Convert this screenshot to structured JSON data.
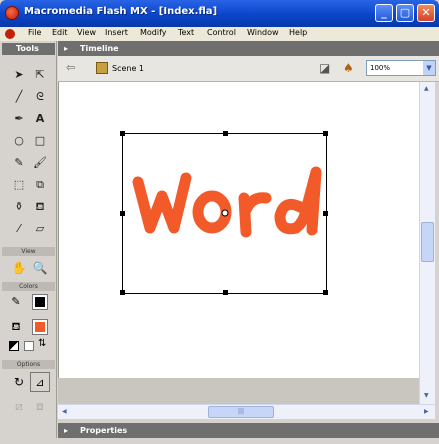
{
  "window": {
    "title": "Macromedia Flash MX - [Index.fla]",
    "minimize": "_",
    "maximize": "▢",
    "close": "✕"
  },
  "menu": [
    "File",
    "Edit",
    "View",
    "Insert",
    "Modify",
    "Text",
    "Control",
    "Window",
    "Help"
  ],
  "tools_panel": {
    "title": "Tools",
    "view_label": "View",
    "colors_label": "Colors",
    "options_label": "Options"
  },
  "timeline": {
    "title": "Timeline"
  },
  "editbar": {
    "scene": "Scene 1",
    "zoom": "100%"
  },
  "stage": {
    "word": "Word",
    "word_color": "#f25a2a"
  },
  "properties": {
    "title": "Properties"
  },
  "colors": {
    "stroke": "#000000",
    "fill": "#f25a2a",
    "titlebar": "#0a45c9",
    "panel_header": "#6f6f6f"
  }
}
